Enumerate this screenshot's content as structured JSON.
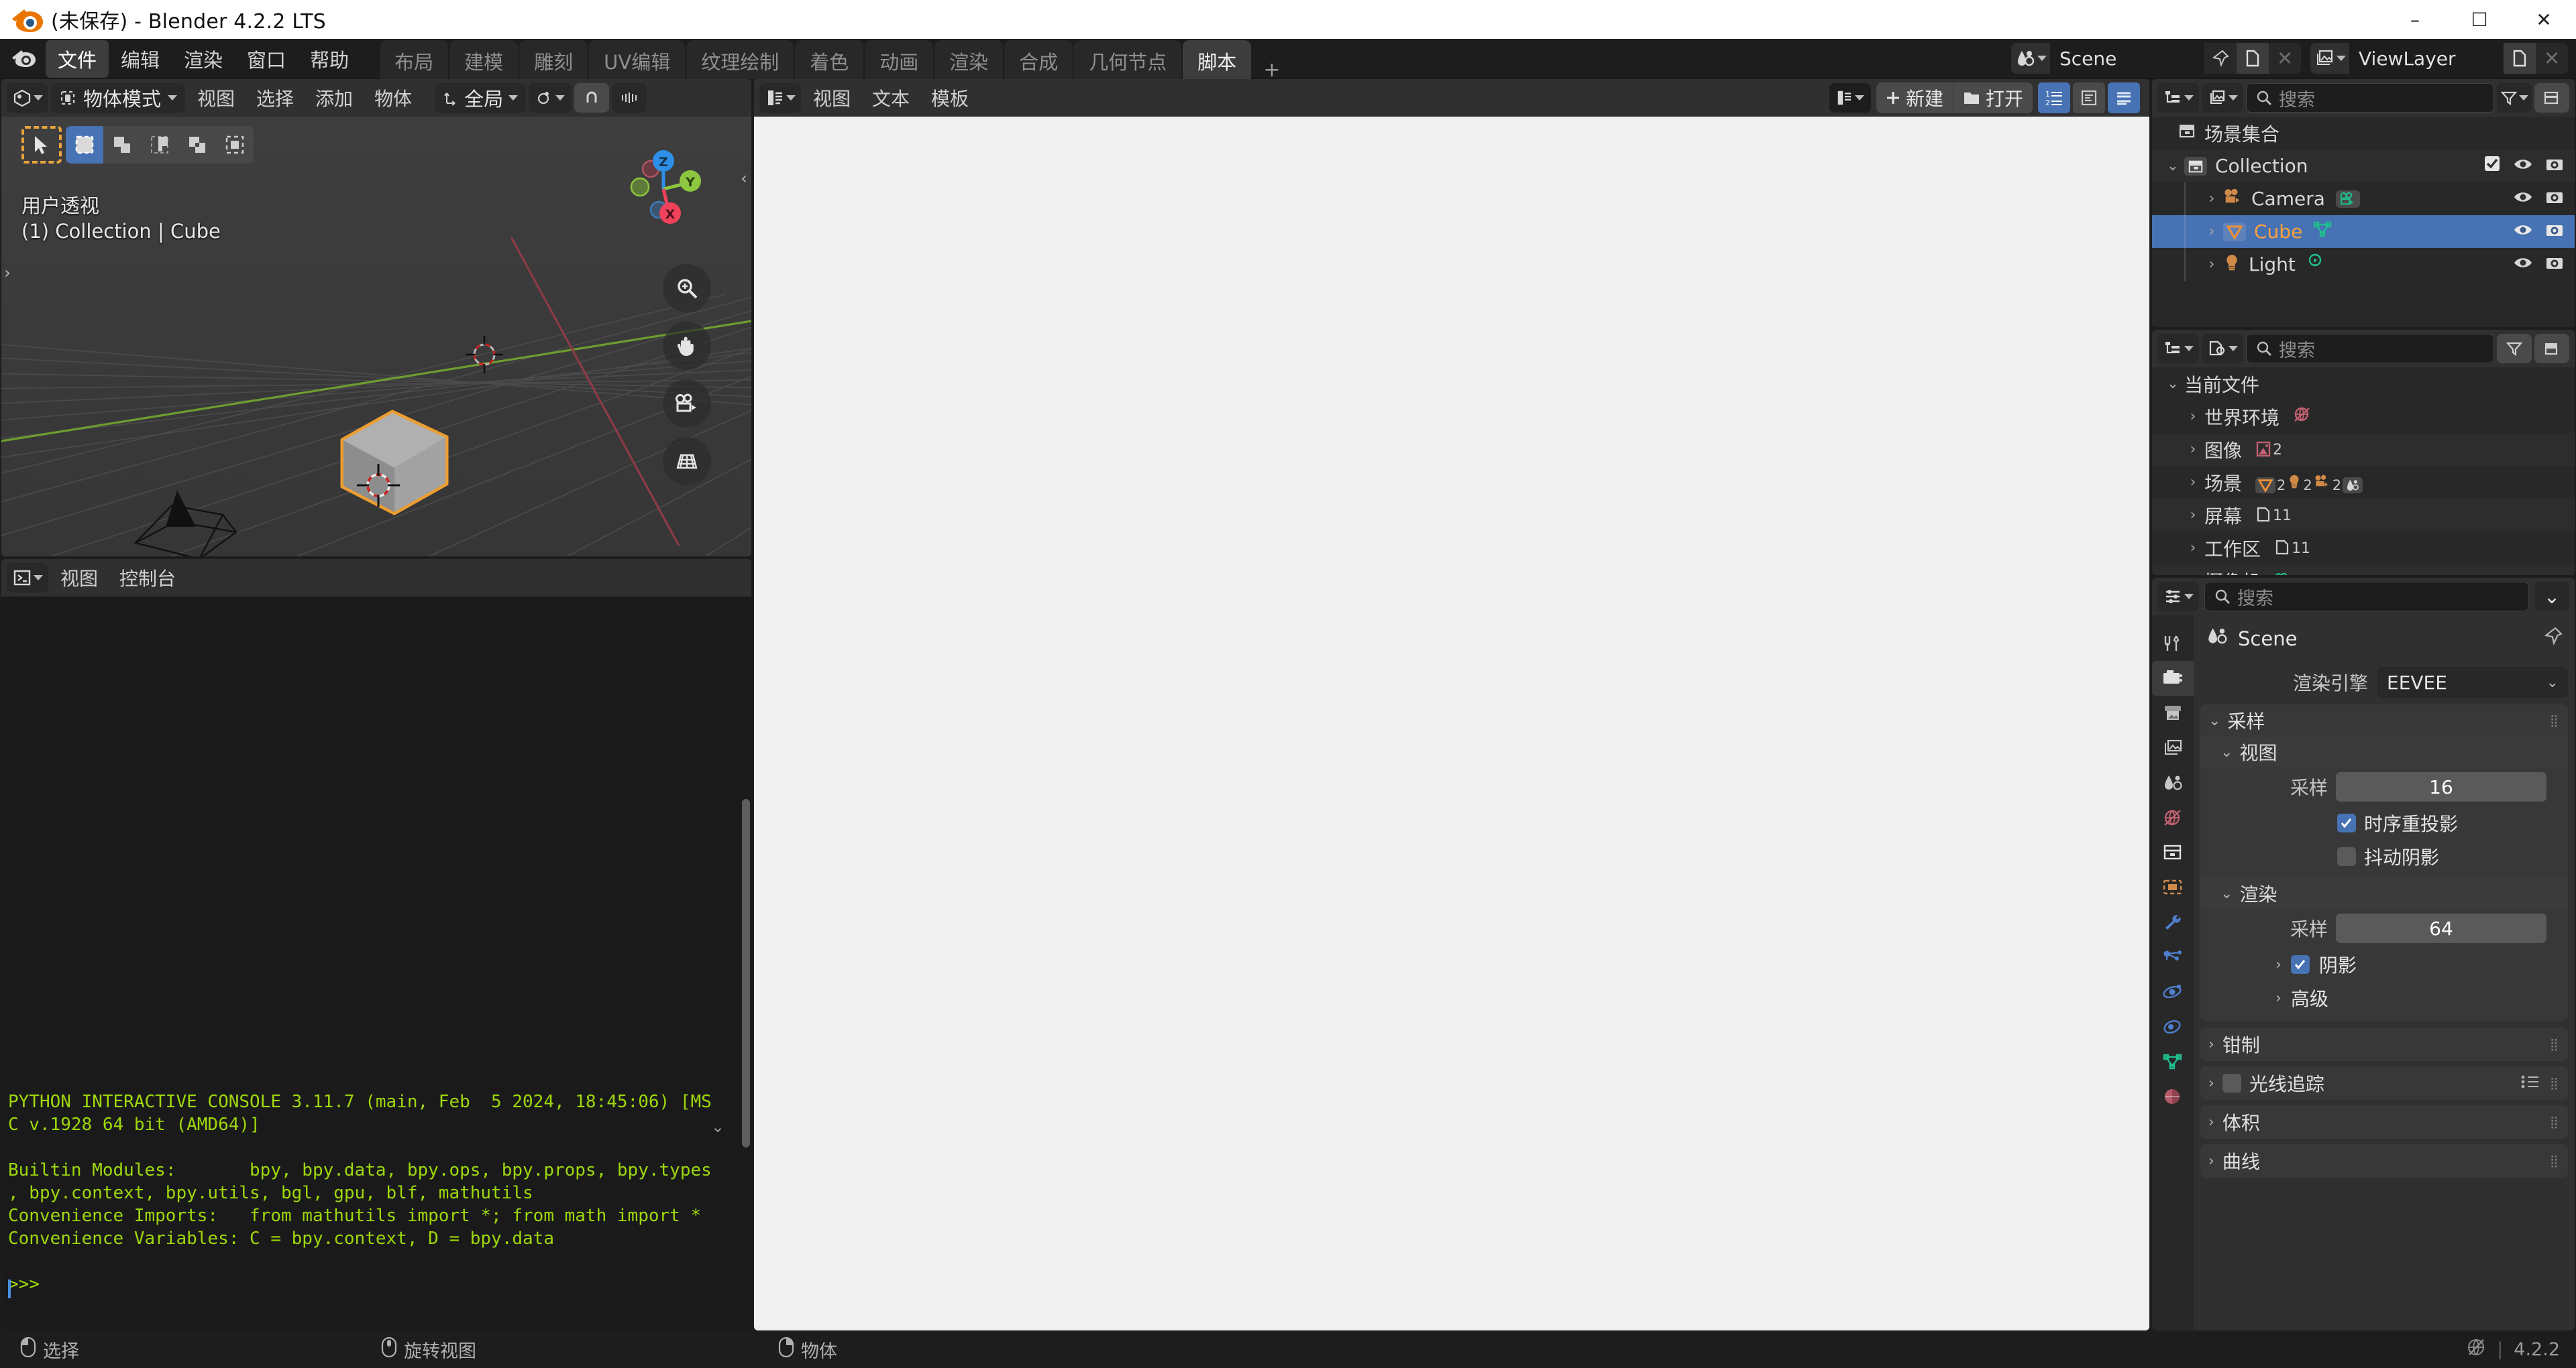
{
  "window": {
    "title": "(未保存) - Blender 4.2.2 LTS",
    "minimize": "–",
    "maximize": "☐",
    "close": "✕"
  },
  "topbar": {
    "menus": [
      "文件",
      "编辑",
      "渲染",
      "窗口",
      "帮助"
    ],
    "active_menu": "文件",
    "workspaces": [
      "布局",
      "建模",
      "雕刻",
      "UV编辑",
      "纹理绘制",
      "着色",
      "动画",
      "渲染",
      "合成",
      "几何节点",
      "脚本"
    ],
    "active_workspace": "脚本",
    "add_workspace": "+",
    "scene_name": "Scene",
    "viewlayer_name": "ViewLayer"
  },
  "viewport": {
    "mode": "物体模式",
    "menus": [
      "视图",
      "选择",
      "添加",
      "物体"
    ],
    "transform_orientation": "全局",
    "overlay_line1": "用户透视",
    "overlay_line2": "(1) Collection | Cube",
    "gizmo_axes": [
      "X",
      "Y",
      "Z"
    ],
    "colors": {
      "x_axis": "#f0425a",
      "y_axis": "#8dc63f",
      "z_axis": "#2e8fe8",
      "selected_outline": "#ed9e2f"
    }
  },
  "console": {
    "menus": [
      "视图",
      "控制台"
    ],
    "text": "PYTHON INTERACTIVE CONSOLE 3.11.7 (main, Feb  5 2024, 18:45:06) [MS\nC v.1928 64 bit (AMD64)]\n\nBuiltin Modules:       bpy, bpy.data, bpy.ops, bpy.props, bpy.types\n, bpy.context, bpy.utils, bgl, gpu, blf, mathutils\nConvenience Imports:   from mathutils import *; from math import *\nConvenience Variables: C = bpy.context, D = bpy.data\n\n>>> ",
    "text_color": "#9ed80b"
  },
  "text_editor": {
    "menus": [
      "视图",
      "文本",
      "模板"
    ],
    "new_label": "新建",
    "open_label": "打开",
    "toggles": [
      "line-numbers",
      "syntax-highlight",
      "word-wrap"
    ]
  },
  "outliner": {
    "search_placeholder": "搜索",
    "rows": [
      {
        "label": "场景集合",
        "indent": 0,
        "icon": "collection-icon",
        "arrow": "",
        "selected": false,
        "has_checkbox": false,
        "has_visibility": false
      },
      {
        "label": "Collection",
        "indent": 1,
        "icon": "collection-icon",
        "arrow": "v",
        "selected": false,
        "has_checkbox": true,
        "has_visibility": true
      },
      {
        "label": "Camera",
        "indent": 2,
        "icon": "camera-icon",
        "arrow": ">",
        "selected": false,
        "has_checkbox": false,
        "has_visibility": true,
        "data_icon": "camera-data-icon"
      },
      {
        "label": "Cube",
        "indent": 2,
        "icon": "mesh-icon",
        "arrow": ">",
        "selected": true,
        "has_checkbox": false,
        "has_visibility": true,
        "data_icon": "mesh-data-icon"
      },
      {
        "label": "Light",
        "indent": 2,
        "icon": "light-icon",
        "arrow": ">",
        "selected": false,
        "has_checkbox": false,
        "has_visibility": true,
        "data_icon": "light-data-icon"
      }
    ]
  },
  "blender_file": {
    "search_placeholder": "搜索",
    "root": "当前文件",
    "rows": [
      {
        "label": "世界环境",
        "counts": [],
        "icon": "world-icon"
      },
      {
        "label": "图像",
        "counts": [
          "2"
        ],
        "icon": "image-icon"
      },
      {
        "label": "场景",
        "counts": [
          "2",
          "2",
          "2"
        ],
        "icon": "scene-icon"
      },
      {
        "label": "屏幕",
        "counts": [
          "11"
        ],
        "icon": "screen-icon"
      },
      {
        "label": "工作区",
        "counts": [
          "11"
        ],
        "icon": "workspace-icon"
      },
      {
        "label": "摄像机",
        "counts": [],
        "icon": "camera-data-icon"
      }
    ]
  },
  "properties": {
    "search_placeholder": "搜索",
    "id_name": "Scene",
    "render_engine_label": "渲染引擎",
    "render_engine_value": "EEVEE",
    "sampling": {
      "title": "采样",
      "viewport": {
        "title": "视图",
        "samples_label": "采样",
        "samples_value": "16",
        "checkboxes": [
          {
            "label": "时序重投影",
            "checked": true
          },
          {
            "label": "抖动阴影",
            "checked": false
          }
        ]
      },
      "render": {
        "title": "渲染",
        "samples_label": "采样",
        "samples_value": "64",
        "shadows_label": "阴影",
        "shadows_checked": true,
        "advanced_label": "高级"
      }
    },
    "closed_panels": [
      {
        "label": "钳制",
        "has_checkbox": false,
        "has_preset": false
      },
      {
        "label": "光线追踪",
        "has_checkbox": true,
        "checked": false,
        "has_preset": true
      },
      {
        "label": "体积",
        "has_checkbox": false,
        "has_preset": false
      },
      {
        "label": "曲线",
        "has_checkbox": false,
        "has_preset": false
      }
    ],
    "tabs": [
      "tool-icon",
      "render-icon",
      "output-icon",
      "viewlayer-icon",
      "scene-icon",
      "world-icon",
      "collection-icon",
      "object-icon",
      "modifier-icon",
      "particles-icon",
      "physics-icon",
      "constraint-icon",
      "data-icon",
      "material-icon"
    ],
    "active_tab": "render-icon"
  },
  "statusbar": {
    "items": [
      {
        "icon": "mouse-left-icon",
        "label": "选择"
      },
      {
        "icon": "mouse-middle-icon",
        "label": "旋转视图"
      },
      {
        "icon": "mouse-right-icon",
        "label": "物体"
      }
    ],
    "version": "4.2.2",
    "network_icon": "no-network-icon"
  }
}
